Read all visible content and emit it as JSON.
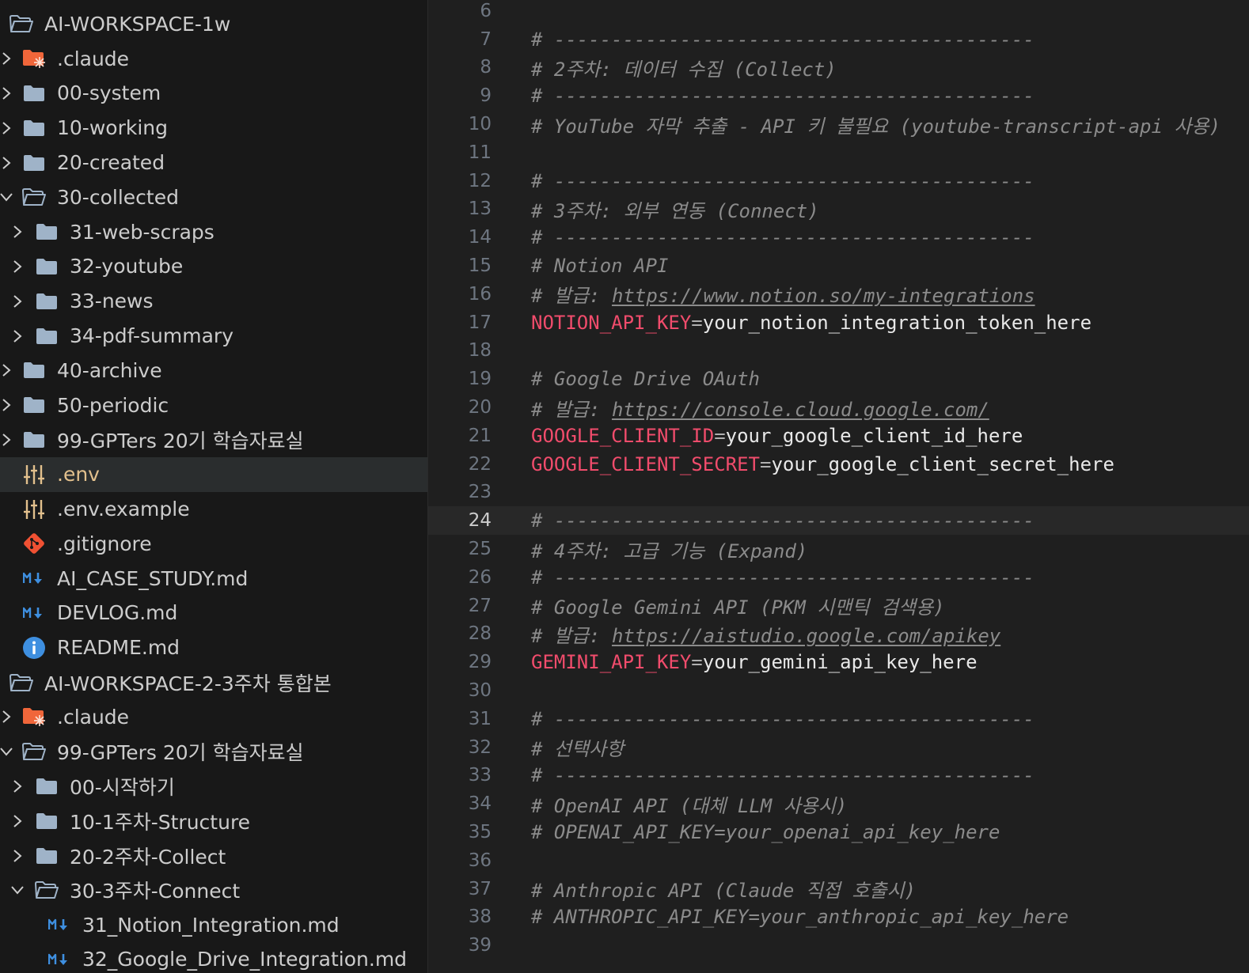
{
  "explorer": {
    "items": [
      {
        "label": "AI-WORKSPACE-1w",
        "level": 0,
        "kind": "folder-open",
        "chevron": "none"
      },
      {
        "label": ".claude",
        "level": 1,
        "kind": "claude-folder",
        "chevron": "right"
      },
      {
        "label": "00-system",
        "level": 1,
        "kind": "folder",
        "chevron": "right"
      },
      {
        "label": "10-working",
        "level": 1,
        "kind": "folder",
        "chevron": "right"
      },
      {
        "label": "20-created",
        "level": 1,
        "kind": "folder",
        "chevron": "right"
      },
      {
        "label": "30-collected",
        "level": 1,
        "kind": "folder-open",
        "chevron": "down"
      },
      {
        "label": "31-web-scraps",
        "level": 2,
        "kind": "folder",
        "chevron": "right"
      },
      {
        "label": "32-youtube",
        "level": 2,
        "kind": "folder",
        "chevron": "right"
      },
      {
        "label": "33-news",
        "level": 2,
        "kind": "folder",
        "chevron": "right"
      },
      {
        "label": "34-pdf-summary",
        "level": 2,
        "kind": "folder",
        "chevron": "right"
      },
      {
        "label": "40-archive",
        "level": 1,
        "kind": "folder",
        "chevron": "right"
      },
      {
        "label": "50-periodic",
        "level": 1,
        "kind": "folder",
        "chevron": "right"
      },
      {
        "label": "99-GPTers 20기 학습자료실",
        "level": 1,
        "kind": "folder",
        "chevron": "right"
      },
      {
        "label": ".env",
        "level": 1,
        "kind": "env",
        "chevron": "none",
        "selected": true
      },
      {
        "label": ".env.example",
        "level": 1,
        "kind": "env",
        "chevron": "none"
      },
      {
        "label": ".gitignore",
        "level": 1,
        "kind": "git",
        "chevron": "none"
      },
      {
        "label": "AI_CASE_STUDY.md",
        "level": 1,
        "kind": "md",
        "chevron": "none"
      },
      {
        "label": "DEVLOG.md",
        "level": 1,
        "kind": "md",
        "chevron": "none"
      },
      {
        "label": "README.md",
        "level": 1,
        "kind": "info",
        "chevron": "none"
      },
      {
        "label": "AI-WORKSPACE-2-3주차 통합본",
        "level": 0,
        "kind": "folder-open",
        "chevron": "none"
      },
      {
        "label": ".claude",
        "level": 1,
        "kind": "claude-folder",
        "chevron": "right"
      },
      {
        "label": "99-GPTers 20기 학습자료실",
        "level": 1,
        "kind": "folder-open",
        "chevron": "down"
      },
      {
        "label": "00-시작하기",
        "level": 2,
        "kind": "folder",
        "chevron": "right"
      },
      {
        "label": "10-1주차-Structure",
        "level": 2,
        "kind": "folder",
        "chevron": "right"
      },
      {
        "label": "20-2주차-Collect",
        "level": 2,
        "kind": "folder",
        "chevron": "right"
      },
      {
        "label": "30-3주차-Connect",
        "level": 2,
        "kind": "folder-open",
        "chevron": "down"
      },
      {
        "label": "31_Notion_Integration.md",
        "level": 3,
        "kind": "md",
        "chevron": "none"
      },
      {
        "label": "32_Google_Drive_Integration.md",
        "level": 3,
        "kind": "md",
        "chevron": "none"
      }
    ]
  },
  "editor": {
    "current_line": "24",
    "lines": [
      {
        "n": "6",
        "type": "blank"
      },
      {
        "n": "7",
        "type": "comment",
        "text": "# ------------------------------------------"
      },
      {
        "n": "8",
        "type": "comment",
        "text": "# 2주차: 데이터 수집 (Collect)"
      },
      {
        "n": "9",
        "type": "comment",
        "text": "# ------------------------------------------"
      },
      {
        "n": "10",
        "type": "comment",
        "text": "# YouTube 자막 추출 - API 키 불필요 (youtube-transcript-api 사용)"
      },
      {
        "n": "11",
        "type": "blank"
      },
      {
        "n": "12",
        "type": "comment",
        "text": "# ------------------------------------------"
      },
      {
        "n": "13",
        "type": "comment",
        "text": "# 3주차: 외부 연동 (Connect)"
      },
      {
        "n": "14",
        "type": "comment",
        "text": "# ------------------------------------------"
      },
      {
        "n": "15",
        "type": "comment",
        "text": "# Notion API"
      },
      {
        "n": "16",
        "type": "url",
        "prefix": "# 발급: ",
        "url": "https://www.notion.so/my-integrations"
      },
      {
        "n": "17",
        "type": "kv",
        "key": "NOTION_API_KEY",
        "value": "your_notion_integration_token_here"
      },
      {
        "n": "18",
        "type": "blank"
      },
      {
        "n": "19",
        "type": "comment",
        "text": "# Google Drive OAuth"
      },
      {
        "n": "20",
        "type": "url",
        "prefix": "# 발급: ",
        "url": "https://console.cloud.google.com/"
      },
      {
        "n": "21",
        "type": "kv",
        "key": "GOOGLE_CLIENT_ID",
        "value": "your_google_client_id_here"
      },
      {
        "n": "22",
        "type": "kv",
        "key": "GOOGLE_CLIENT_SECRET",
        "value": "your_google_client_secret_here"
      },
      {
        "n": "23",
        "type": "blank"
      },
      {
        "n": "24",
        "type": "comment",
        "text": "# ------------------------------------------"
      },
      {
        "n": "25",
        "type": "comment",
        "text": "# 4주차: 고급 기능 (Expand)"
      },
      {
        "n": "26",
        "type": "comment",
        "text": "# ------------------------------------------"
      },
      {
        "n": "27",
        "type": "comment",
        "text": "# Google Gemini API (PKM 시맨틱 검색용)"
      },
      {
        "n": "28",
        "type": "url",
        "prefix": "# 발급: ",
        "url": "https://aistudio.google.com/apikey"
      },
      {
        "n": "29",
        "type": "kv",
        "key": "GEMINI_API_KEY",
        "value": "your_gemini_api_key_here"
      },
      {
        "n": "30",
        "type": "blank"
      },
      {
        "n": "31",
        "type": "comment",
        "text": "# ------------------------------------------"
      },
      {
        "n": "32",
        "type": "comment",
        "text": "# 선택사항"
      },
      {
        "n": "33",
        "type": "comment",
        "text": "# ------------------------------------------"
      },
      {
        "n": "34",
        "type": "comment",
        "text": "# OpenAI API (대체 LLM 사용시)"
      },
      {
        "n": "35",
        "type": "comment",
        "text": "# OPENAI_API_KEY=your_openai_api_key_here"
      },
      {
        "n": "36",
        "type": "blank"
      },
      {
        "n": "37",
        "type": "comment",
        "text": "# Anthropic API (Claude 직접 호출시)"
      },
      {
        "n": "38",
        "type": "comment",
        "text": "# ANTHROPIC_API_KEY=your_anthropic_api_key_here"
      },
      {
        "n": "39",
        "type": "blank"
      }
    ]
  },
  "colors": {
    "sidebar_bg": "#181818",
    "editor_bg": "#1f1f1f",
    "selection_bg": "#2a2d2e",
    "folder_icon": "#9fb3c8",
    "claude_icon": "#f0663a",
    "env_icon": "#e2c08d",
    "git_icon": "#f05133",
    "md_icon": "#3e8fe0",
    "info_icon": "#3e8fe0",
    "comment": "#8b8b8b",
    "env_key": "#f14c6c",
    "env_value": "#e8e8e8"
  }
}
